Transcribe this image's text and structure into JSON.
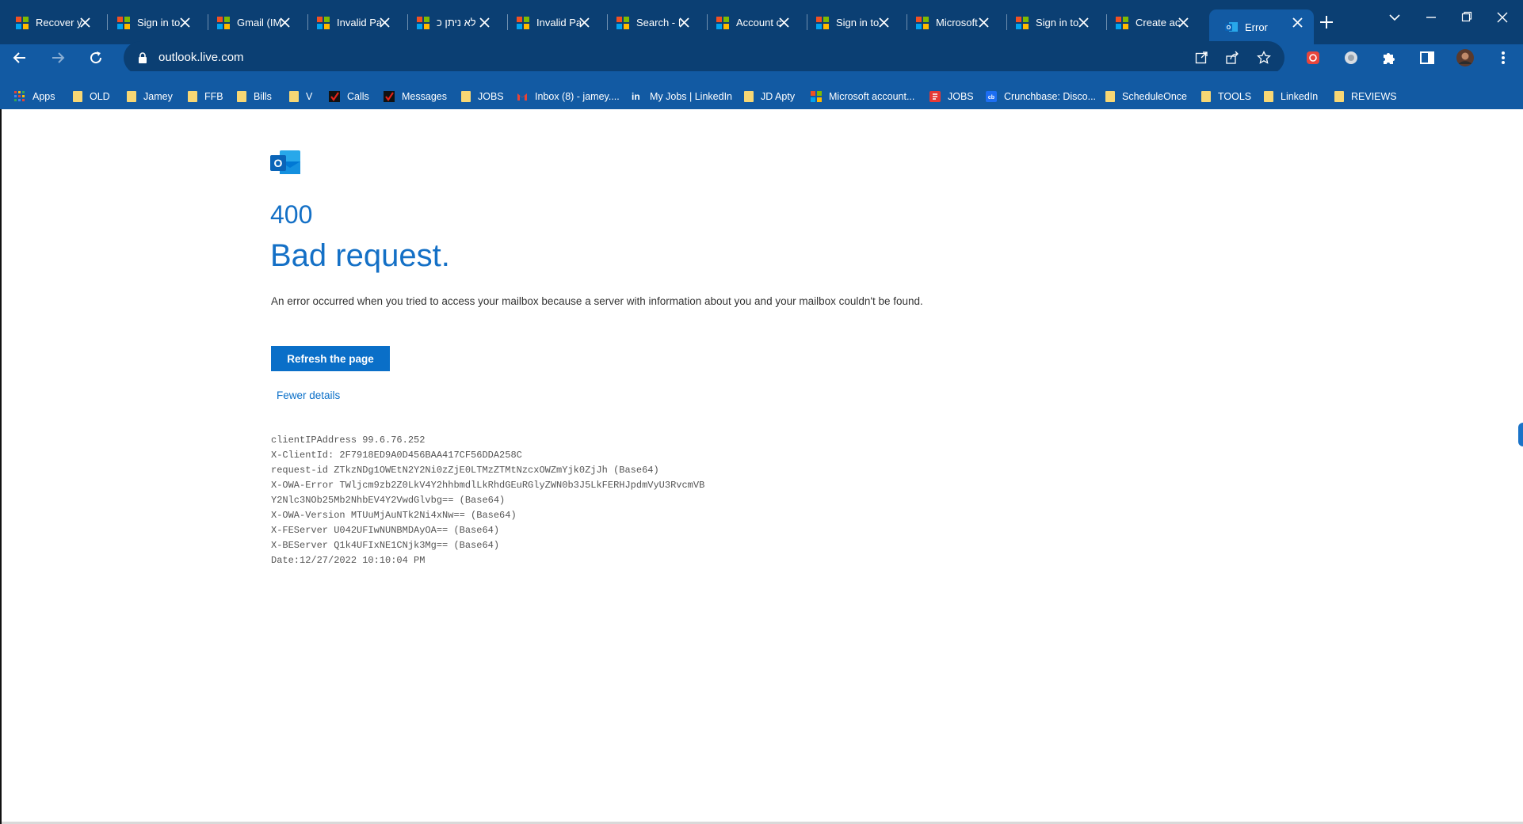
{
  "browser": {
    "tabs": [
      {
        "title": "Recover y",
        "favicon": "microsoft-logo",
        "active": false
      },
      {
        "title": "Sign in to",
        "favicon": "microsoft-logo",
        "active": false
      },
      {
        "title": "Gmail (IM",
        "favicon": "microsoft-logo",
        "active": false
      },
      {
        "title": "Invalid Pa",
        "favicon": "microsoft-logo",
        "active": false
      },
      {
        "title": "לא ניתן כ",
        "favicon": "microsoft-logo",
        "active": false
      },
      {
        "title": "Invalid Pa",
        "favicon": "microsoft-logo",
        "active": false
      },
      {
        "title": "Search - I",
        "favicon": "microsoft-logo",
        "active": false
      },
      {
        "title": "Account c",
        "favicon": "microsoft-logo",
        "active": false
      },
      {
        "title": "Sign in to",
        "favicon": "microsoft-logo",
        "active": false
      },
      {
        "title": "Microsoft",
        "favicon": "microsoft-logo",
        "active": false
      },
      {
        "title": "Sign in to",
        "favicon": "microsoft-logo",
        "active": false
      },
      {
        "title": "Create ac",
        "favicon": "microsoft-logo",
        "active": false
      },
      {
        "title": "Error",
        "favicon": "outlook-icon",
        "active": true
      }
    ],
    "url": "outlook.live.com",
    "bookmarks": [
      {
        "label": "Apps",
        "icon": "apps-grid-icon"
      },
      {
        "label": "OLD",
        "icon": "folder-icon"
      },
      {
        "label": "Jamey",
        "icon": "folder-icon"
      },
      {
        "label": "FFB",
        "icon": "folder-icon"
      },
      {
        "label": "Bills",
        "icon": "folder-icon"
      },
      {
        "label": "V",
        "icon": "folder-icon"
      },
      {
        "label": "Calls",
        "icon": "verizon-check-icon"
      },
      {
        "label": "Messages",
        "icon": "verizon-check-icon"
      },
      {
        "label": "JOBS",
        "icon": "folder-icon"
      },
      {
        "label": "Inbox (8) - jamey....",
        "icon": "gmail-icon"
      },
      {
        "label": "My Jobs | LinkedIn",
        "icon": "linkedin-icon"
      },
      {
        "label": "JD Apty",
        "icon": "folder-icon"
      },
      {
        "label": "Microsoft account...",
        "icon": "microsoft-logo"
      },
      {
        "label": "JOBS",
        "icon": "jobs-red-icon"
      },
      {
        "label": "Crunchbase: Disco...",
        "icon": "crunchbase-icon"
      },
      {
        "label": "ScheduleOnce",
        "icon": "folder-icon"
      },
      {
        "label": "TOOLS",
        "icon": "folder-icon"
      },
      {
        "label": "LinkedIn",
        "icon": "folder-icon"
      },
      {
        "label": "REVIEWS",
        "icon": "folder-icon"
      }
    ],
    "colors": {
      "tabstrip": "#0b3f73",
      "toolbar": "#125aa3",
      "accent": "#0a6fc8"
    }
  },
  "page": {
    "error_code": "400",
    "title": "Bad request.",
    "message": "An error occurred when you tried to access your mailbox because a server with information about you and your mailbox couldn't be found.",
    "refresh_label": "Refresh the page",
    "details_toggle": "Fewer details",
    "details": [
      "clientIPAddress 99.6.76.252",
      "X-ClientId: 2F7918ED9A0D456BAA417CF56DDA258C",
      "request-id ZTkzNDg1OWEtN2Y2Ni0zZjE0LTMzZTMtNzcxOWZmYjk0ZjJh (Base64)",
      "X-OWA-Error TWljcm9zb2Z0LkV4Y2hhbmdlLkRhdGEuRGlyZWN0b3J5LkFERHJpdmVyU3RvcmVB",
      "Y2Nlc3NOb25Mb2NhbEV4Y2VwdGlvbg== (Base64)",
      "X-OWA-Version MTUuMjAuNTk2Ni4xNw== (Base64)",
      "X-FEServer U042UFIwNUNBMDAyOA== (Base64)",
      "X-BEServer Q1k4UFIxNE1CNjk3Mg== (Base64)",
      "Date:12/27/2022 10:10:04 PM"
    ]
  }
}
